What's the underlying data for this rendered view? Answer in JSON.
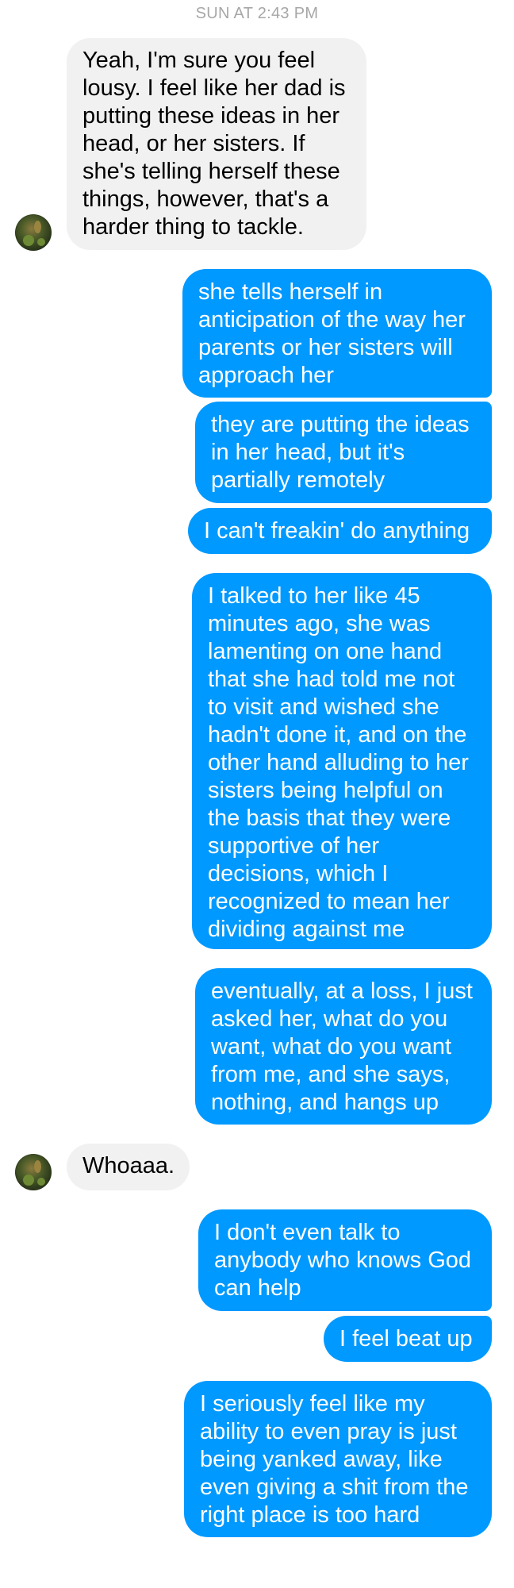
{
  "conversation": {
    "timestamp": "SUN AT 2:43 PM",
    "contact_avatar_icon": "profile-photo",
    "colors": {
      "outgoing_bubble": "#0099ff",
      "incoming_bubble": "#f1f1f1",
      "timestamp_text": "#a7a7a7"
    },
    "messages": [
      {
        "direction": "incoming",
        "text": "Yeah, I'm sure you feel lousy. I feel like her dad is putting these ideas in her head, or her sisters. If she's telling herself these things, however, that's a harder thing to tackle."
      },
      {
        "direction": "outgoing",
        "text": "she tells herself in anticipation of the way her parents or her sisters will approach her"
      },
      {
        "direction": "outgoing",
        "text": "they are putting the ideas in her head, but it's partially remotely"
      },
      {
        "direction": "outgoing",
        "text": "I can't freakin' do anything"
      },
      {
        "direction": "outgoing",
        "text": "I talked to her like 45 minutes ago, she was lamenting on one hand that she had told me not to visit and wished she hadn't done it, and on the other hand alluding to her sisters being helpful on the basis that they were supportive of her decisions, which I recognized to mean her dividing against me"
      },
      {
        "direction": "outgoing",
        "text": "eventually, at a loss, I just asked her, what do you want, what do you want from me, and she says, nothing, and hangs up"
      },
      {
        "direction": "incoming",
        "text": "Whoaaa."
      },
      {
        "direction": "outgoing",
        "text": "I don't even talk to anybody who knows God can help"
      },
      {
        "direction": "outgoing",
        "text": "I feel beat up"
      },
      {
        "direction": "outgoing",
        "text": "I seriously feel like my ability to even pray is just being yanked away, like even giving a shit from the right place is too hard"
      }
    ]
  }
}
